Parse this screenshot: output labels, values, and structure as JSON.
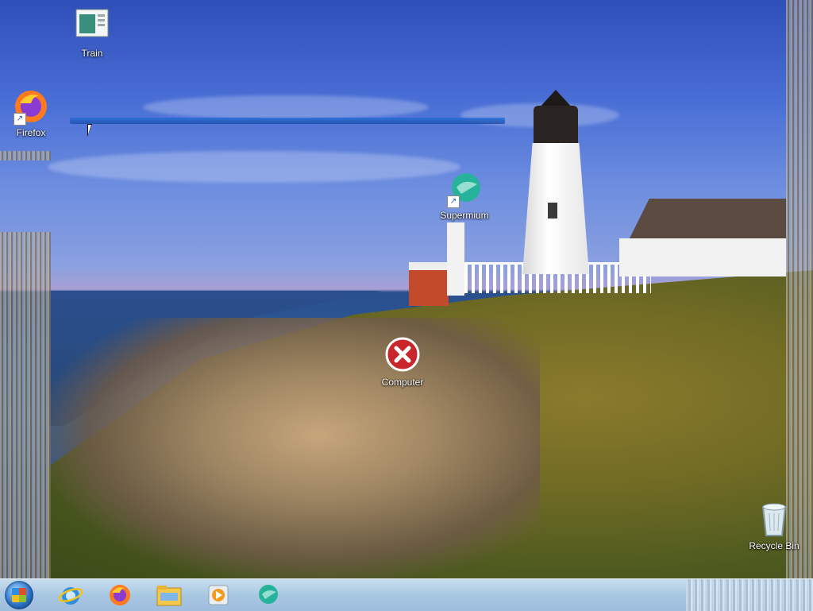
{
  "desktop": {
    "icons": [
      {
        "id": "train",
        "label": "Train",
        "shortcut": false
      },
      {
        "id": "firefox",
        "label": "Firefox",
        "shortcut": true
      },
      {
        "id": "supermium",
        "label": "Supermium",
        "shortcut": true
      },
      {
        "id": "computer",
        "label": "Computer",
        "shortcut": false
      },
      {
        "id": "recycle-bin",
        "label": "Recycle Bin",
        "shortcut": false
      }
    ]
  },
  "taskbar": {
    "start_icon": "windows-orb-icon",
    "pinned": [
      "internet-explorer-icon",
      "firefox-icon",
      "file-explorer-icon",
      "media-player-icon",
      "supermium-icon"
    ]
  },
  "colors": {
    "taskbar": "#a8c7e2",
    "progress": "#2a6ed8",
    "error_red": "#c9262c"
  }
}
